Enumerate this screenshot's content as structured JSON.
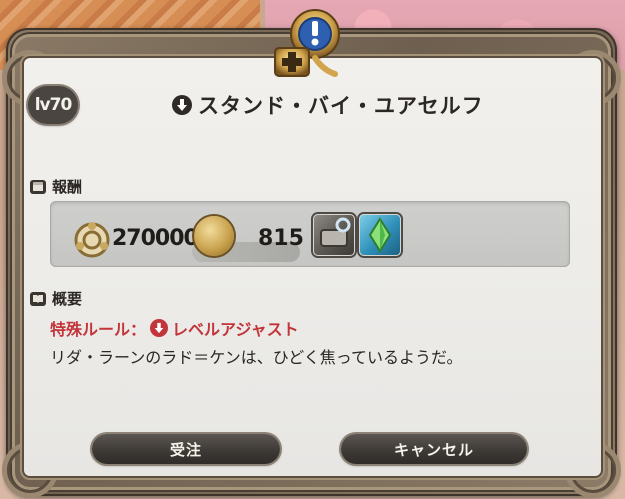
{
  "quest": {
    "level": "lv70",
    "title": "スタンド・バイ・ユアセルフ"
  },
  "rewards": {
    "heading": "報酬",
    "gil": "270000",
    "grand_company_seals": "815",
    "items": [
      {
        "icon": "gear-item-icon"
      },
      {
        "icon": "crystal-item-icon"
      }
    ]
  },
  "summary": {
    "heading": "概要",
    "special_rule": "特殊ルール：",
    "special_rule_value": "レベルアジャスト",
    "description": "リダ・ラーンのラド＝ケンは、ひどく焦っているようだ。"
  },
  "buttons": {
    "accept": "受注",
    "cancel": "キャンセル"
  },
  "colors": {
    "rule_red": "#c2353a",
    "panel_bg": "#ecebe8",
    "frame_gold": "#9a8870"
  }
}
